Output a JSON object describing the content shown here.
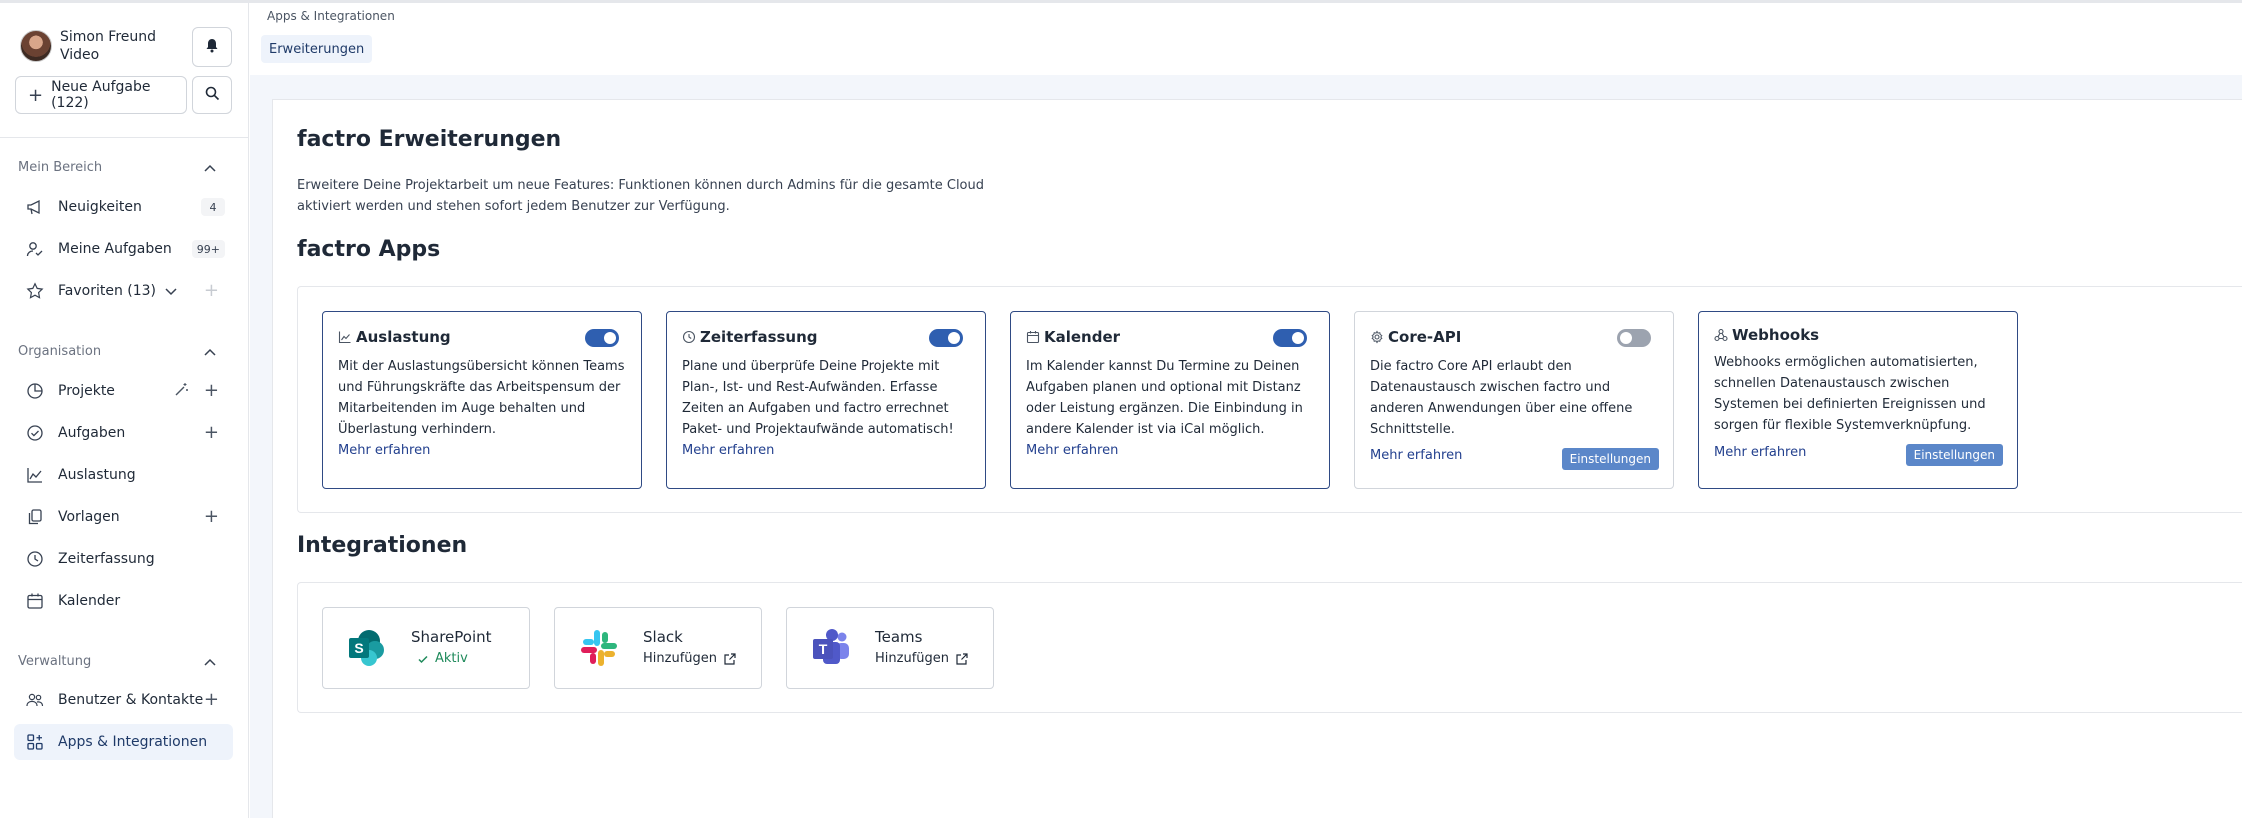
{
  "user": {
    "name": "Simon Freund",
    "role": "Video"
  },
  "sidebar": {
    "new_task_label": "Neue Aufgabe (122)",
    "sections": {
      "mein_bereich": "Mein Bereich",
      "organisation": "Organisation",
      "verwaltung": "Verwaltung"
    },
    "items": {
      "neuigkeiten": {
        "label": "Neuigkeiten",
        "badge": "4"
      },
      "meine_aufgaben": {
        "label": "Meine Aufgaben",
        "badge": "99+"
      },
      "favoriten": {
        "label": "Favoriten (13)"
      },
      "projekte": {
        "label": "Projekte"
      },
      "aufgaben": {
        "label": "Aufgaben"
      },
      "auslastung": {
        "label": "Auslastung"
      },
      "vorlagen": {
        "label": "Vorlagen"
      },
      "zeiterfassung": {
        "label": "Zeiterfassung"
      },
      "kalender": {
        "label": "Kalender"
      },
      "benutzer": {
        "label": "Benutzer & Kontakte"
      },
      "apps": {
        "label": "Apps & Integrationen"
      }
    }
  },
  "header": {
    "breadcrumb": "Apps & Integrationen",
    "tab": "Erweiterungen"
  },
  "main": {
    "title": "factro Erweiterungen",
    "description": "Erweitere Deine Projektarbeit um neue Features: Funktionen können durch Admins für die gesamte Cloud aktiviert werden und stehen sofort jedem Benutzer zur Verfügung.",
    "apps_title": "factro Apps",
    "integrations_title": "Integrationen",
    "more_label": "Mehr erfahren",
    "settings_label": "Einstellungen",
    "apps": [
      {
        "title": "Auslastung",
        "enabled": true,
        "text": "Mit der Auslastungsübersicht können Teams und Führungskräfte das Arbeitspensum der Mitarbeitenden im Auge behalten und Überlastung verhindern."
      },
      {
        "title": "Zeiterfassung",
        "enabled": true,
        "text": "Plane und überprüfe Deine Projekte mit Plan-, Ist- und Rest-Aufwänden. Erfasse Zeiten an Aufgaben und factro errechnet Paket- und Projektaufwände automatisch!"
      },
      {
        "title": "Kalender",
        "enabled": true,
        "text": "Im Kalender kannst Du Termine zu Deinen Aufgaben planen und optional mit Distanz oder Leistung ergänzen. Die Einbindung in andere Kalender ist via iCal möglich."
      },
      {
        "title": "Core-API",
        "enabled": false,
        "text": "Die factro Core API erlaubt den Datenaustausch zwischen factro und anderen Anwendungen über eine offene Schnittstelle."
      },
      {
        "title": "Webhooks",
        "enabled": true,
        "text": "Webhooks ermöglichen automatisierten, schnellen Datenaustausch zwischen Systemen bei definierten Ereignissen und sorgen für flexible Systemverknüpfung."
      }
    ],
    "integrations": [
      {
        "title": "SharePoint",
        "status": "Aktiv"
      },
      {
        "title": "Slack",
        "status": "Hinzufügen"
      },
      {
        "title": "Teams",
        "status": "Hinzufügen"
      }
    ]
  },
  "colors": {
    "accent": "#2f5fb0",
    "border_active": "#2f4a84",
    "link": "#23408e",
    "success": "#1f8a5b",
    "sidebar_active_bg": "#eef3fb"
  }
}
